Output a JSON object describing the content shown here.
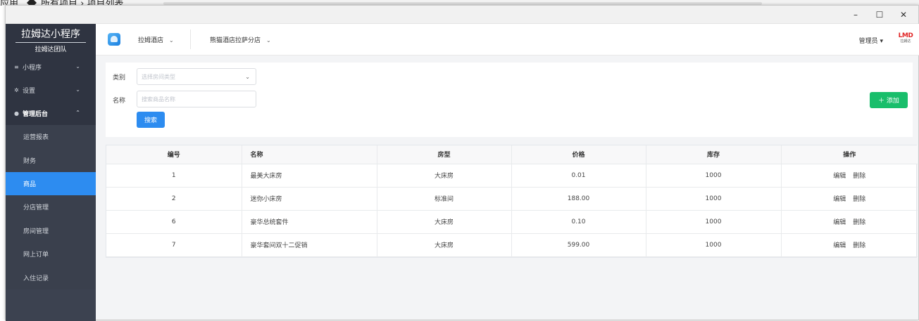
{
  "background_window": {
    "breadcrumb_app": "应用",
    "breadcrumb_all": "所有项目",
    "breadcrumb_list": "项目列表"
  },
  "window_controls": {
    "minimize": "–",
    "maximize": "☐",
    "close": "✕"
  },
  "sidebar": {
    "brand_name": "拉姆达小程序",
    "brand_team": "拉姆达团队",
    "groups": [
      {
        "label": "小程序",
        "icon": "list-icon",
        "chevron": "⌄"
      },
      {
        "label": "设置",
        "icon": "gear-icon",
        "chevron": "⌄"
      },
      {
        "label": "管理后台",
        "icon": "circle-icon",
        "chevron": "⌃"
      }
    ],
    "sub_items": [
      {
        "label": "运营报表",
        "active": false
      },
      {
        "label": "财务",
        "active": false
      },
      {
        "label": "商品",
        "active": true
      },
      {
        "label": "分店管理",
        "active": false
      },
      {
        "label": "房间管理",
        "active": false
      },
      {
        "label": "网上订单",
        "active": false
      },
      {
        "label": "入住记录",
        "active": false
      }
    ]
  },
  "topbar": {
    "hotel_select": "拉姆酒店",
    "branch_select": "熊猫酒店拉萨分店",
    "user": "管理员",
    "logo_text": "LMD",
    "logo_sub": "拉姆达"
  },
  "filter": {
    "category_label": "类别",
    "category_placeholder": "选择房间类型",
    "name_label": "名称",
    "name_placeholder": "搜索商品名称",
    "search_button": "搜索",
    "add_button": "＋ 添加"
  },
  "table": {
    "headers": [
      "编号",
      "名称",
      "房型",
      "价格",
      "库存",
      "操作"
    ],
    "rows": [
      {
        "id": "1",
        "name": "最美大床房",
        "room_type": "大床房",
        "price": "0.01",
        "stock": "1000"
      },
      {
        "id": "2",
        "name": "迷你小床房",
        "room_type": "标准间",
        "price": "188.00",
        "stock": "1000"
      },
      {
        "id": "6",
        "name": "豪华总统套件",
        "room_type": "大床房",
        "price": "0.10",
        "stock": "1000"
      },
      {
        "id": "7",
        "name": "豪华套间双十二促销",
        "room_type": "大床房",
        "price": "599.00",
        "stock": "1000"
      }
    ],
    "edit_label": "编辑",
    "delete_label": "删除"
  },
  "colors": {
    "sidebar_bg": "#2f3441",
    "active_blue": "#2d8cf0",
    "add_green": "#19be6b"
  }
}
